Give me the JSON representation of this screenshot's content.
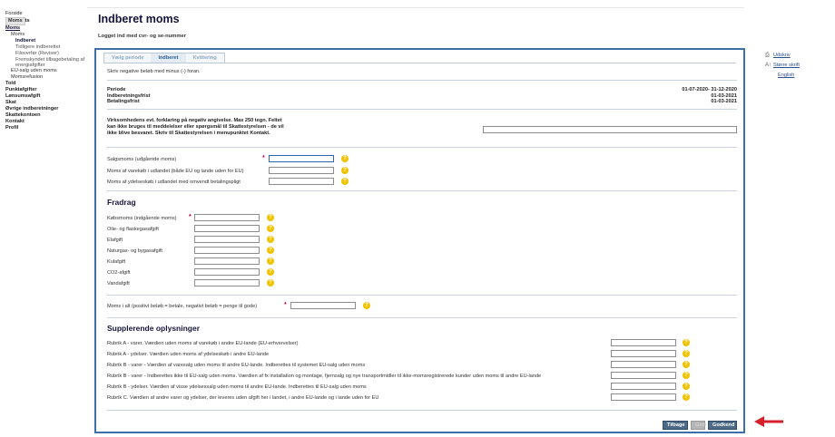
{
  "header": {
    "title": "Indberet moms",
    "login_text": "Logget ind med cvr- og se-nummer"
  },
  "leftnav": {
    "tooltip": "Moms",
    "items": [
      {
        "label": "Forside",
        "level": 0
      },
      {
        "label": "Moms",
        "level": 0
      },
      {
        "label": "Moms",
        "level": 1
      },
      {
        "label": "Indberet",
        "level": 2
      },
      {
        "label": "Tidligere indberettet",
        "level": 2
      },
      {
        "label": "Filoverfør (Revisor)",
        "level": 2
      },
      {
        "label": "Fremskyndet tilbagebetaling af energiafgifter",
        "level": 2
      },
      {
        "label": "EU-salg uden moms",
        "level": 1
      },
      {
        "label": "Momsrefusion",
        "level": 1
      },
      {
        "label": "Told",
        "level": 0
      },
      {
        "label": "Punktafgifter",
        "level": 0
      },
      {
        "label": "Lønsumsafgift",
        "level": 0
      },
      {
        "label": "Skat",
        "level": 0
      },
      {
        "label": "Øvrige indberetninger",
        "level": 0
      },
      {
        "label": "Skattekontoen",
        "level": 0
      },
      {
        "label": "Kontakt",
        "level": 0
      },
      {
        "label": "Profil",
        "level": 0
      }
    ]
  },
  "rightlinks": {
    "print": "Udskriv",
    "bigger_text": "Større skrift",
    "english": "English"
  },
  "tabs": [
    {
      "label": "Vælg periode",
      "active": false
    },
    {
      "label": "Indberet",
      "active": true
    },
    {
      "label": "Kvittering",
      "active": false
    }
  ],
  "hint": "Skriv negative beløb med minus (-) foran.",
  "period": {
    "labels": [
      "Periode",
      "Indberetningsfrist",
      "Betalingsfrist"
    ],
    "values": [
      "01-07-2020- 31-12-2020",
      "01-03-2021",
      "01-03-2021"
    ]
  },
  "explanation": "Virksomhedens evt. forklaring på negativ angivelse. Max 250 tegn. Feltet kan ikke bruges til meddelelser eller spørgsmål til Skattestyrelsen - de vil ikke blive besvaret. Skriv til Skattestyrelsen i menupunktet Kontakt.",
  "sales": [
    {
      "label": "Salgsmoms (udgående moms)",
      "required": true
    },
    {
      "label": "Moms af varekøb i udlandet (både EU og lande uden for EU)",
      "required": false
    },
    {
      "label": "Moms af ydelseskøb i udlandet med omvendt betalingspligt",
      "required": false
    }
  ],
  "fradrag": {
    "title": "Fradrag",
    "items": [
      {
        "label": "Købsmoms (indgående moms)",
        "required": true
      },
      {
        "label": "Olie- og flaskegasafgift",
        "required": false
      },
      {
        "label": "Elafgift",
        "required": false
      },
      {
        "label": "Naturgas- og bygasafgift",
        "required": false
      },
      {
        "label": "Kulafgift",
        "required": false
      },
      {
        "label": "CO2-afgift",
        "required": false
      },
      {
        "label": "Vandafgift",
        "required": false
      }
    ]
  },
  "total": {
    "label": "Moms i alt (positivt beløb = betale, negativt beløb = penge til gode)",
    "required": true
  },
  "supplerende": {
    "title": "Supplerende oplysninger",
    "items": [
      "Rubrik A - varer. Værdien uden moms af varekøb i andre EU-lande (EU-erhvervelser)",
      "Rubrik A - ydelser. Værdien uden moms af ydelseskøb i andre EU-lande",
      "Rubrik B - varer - Værdien af varesalg uden moms til andre EU-lande. Indberettes til systemet EU-salg uden moms",
      "Rubrik B - varer - Indberettes ikke til EU-salg uden moms. Værdien af fx installation og montage, fjernsalg og nye transportmidler til ikke-momsregistrerede kunder uden moms til andre EU-lande",
      "Rubrik B - ydelser. Værdien af visse ydelsessalg uden moms til andre EU-lande. Indberettes til EU-salg uden moms",
      "Rubrik C. Værdien af andre varer og ydelser, der leveres uden afgift her i landet, i andre EU-lande og i lande uden for EU"
    ]
  },
  "buttons": {
    "back": "Tilbage",
    "middle": "Gem",
    "approve": "Godkend"
  },
  "colors": {
    "frame_border": "#3e70a8",
    "help_icon": "#f2c200",
    "required_marker": "#c0004d",
    "arrow": "#d6202a",
    "button": "#4d6a86"
  }
}
